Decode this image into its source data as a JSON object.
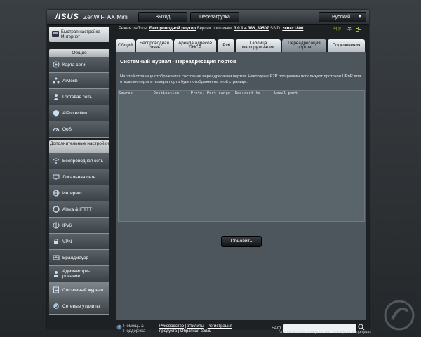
{
  "header": {
    "logo": "/ISUS",
    "model": "ZenWiFi AX Mini",
    "logout_label": "Выход",
    "reboot_label": "Перезагрузка",
    "language": "Русский"
  },
  "info": {
    "mode_label": "Режим работы:",
    "mode_value": "Беспроводной роутер",
    "firmware_label": "Версия прошивки:",
    "firmware_value": "3.0.0.4.386_39507",
    "ssid_label": "SSID:",
    "ssid_value": "zenax1800",
    "app_label": "App"
  },
  "sidebar": {
    "quick_setup": "Быстрая настройка Интернет",
    "general_heading": "Общие",
    "general_items": [
      {
        "label": "Карта сети",
        "icon": "network-map-icon"
      },
      {
        "label": "AiMesh",
        "icon": "aimesh-icon"
      },
      {
        "label": "Гостевая сеть",
        "icon": "guest-network-icon"
      },
      {
        "label": "AiProtection",
        "icon": "aiprotection-icon"
      },
      {
        "label": "QoS",
        "icon": "qos-icon"
      }
    ],
    "advanced_heading": "Дополнительные настройки",
    "advanced_items": [
      {
        "label": "Беспроводная сеть",
        "icon": "wireless-icon"
      },
      {
        "label": "Локальная сеть",
        "icon": "lan-icon"
      },
      {
        "label": "Интернет",
        "icon": "wan-icon"
      },
      {
        "label": "Alexa & IFTTT",
        "icon": "alexa-icon"
      },
      {
        "label": "IPv6",
        "icon": "ipv6-icon"
      },
      {
        "label": "VPN",
        "icon": "vpn-icon"
      },
      {
        "label": "Брандмауэр",
        "icon": "firewall-icon"
      },
      {
        "label": "Администри-рование",
        "icon": "administration-icon"
      },
      {
        "label": "Системный журнал",
        "icon": "system-log-icon",
        "active": true
      },
      {
        "label": "Сетевые утилиты",
        "icon": "network-tools-icon"
      }
    ]
  },
  "tabs": [
    {
      "label": "Общий"
    },
    {
      "label": "Беспроводная связь"
    },
    {
      "label": "Аренда адресов DHCP"
    },
    {
      "label": "IPv6"
    },
    {
      "label": "Таблица маршрутизации"
    },
    {
      "label": "Переадресация портов",
      "active": true
    },
    {
      "label": "Подключения"
    }
  ],
  "main": {
    "title": "Системный журнал - Переадресация портов",
    "description": "На этой странице отображается состояние переадресации портов. Некоторые P2P программы используют протокол UPnP для открытия порта и номера порта будет отображен на этой странице.",
    "log_header": "Source         Destination     Proto. Port range  Redirect to      Local port",
    "refresh_label": "Обновить"
  },
  "footer": {
    "help_label": "Помощь & Поддержка",
    "links": [
      "Руководство",
      "Утилиты",
      "Регистрация продукта",
      "Обратная связь"
    ],
    "faq_label": "FAQ",
    "copyright": "2020 ASUSTeK Computer Inc. Все права защищены."
  },
  "colors": {
    "accent_green": "#8fc32f",
    "panel_bg": "#4c565c"
  }
}
